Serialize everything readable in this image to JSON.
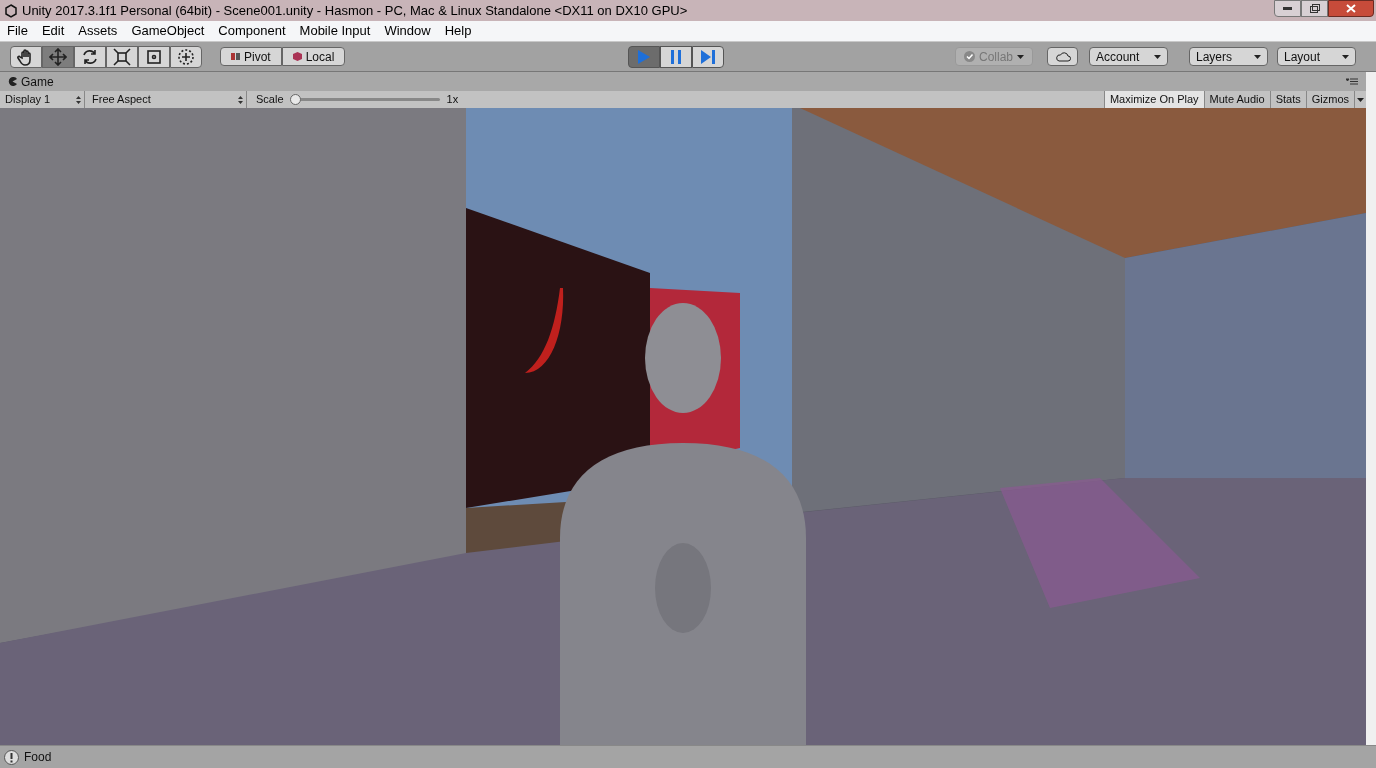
{
  "window": {
    "title": "Unity 2017.3.1f1 Personal (64bit) - Scene001.unity - Hasmon - PC, Mac & Linux Standalone <DX11 on DX10 GPU>"
  },
  "menu": [
    "File",
    "Edit",
    "Assets",
    "GameObject",
    "Component",
    "Mobile Input",
    "Window",
    "Help"
  ],
  "tools": [
    {
      "kind": "hand",
      "selected": false
    },
    {
      "kind": "move",
      "selected": true
    },
    {
      "kind": "rotate",
      "selected": false
    },
    {
      "kind": "scale",
      "selected": false
    },
    {
      "kind": "rect",
      "selected": false
    },
    {
      "kind": "transform",
      "selected": false
    }
  ],
  "pivot": {
    "label": "Pivot"
  },
  "space": {
    "label": "Local"
  },
  "play_controls": [
    {
      "kind": "play",
      "selected": true
    },
    {
      "kind": "pause",
      "selected": false
    },
    {
      "kind": "step",
      "selected": false
    }
  ],
  "collab": {
    "label": "Collab",
    "disabled": true
  },
  "account": {
    "label": "Account"
  },
  "layers": {
    "label": "Layers"
  },
  "layout": {
    "label": "Layout"
  },
  "game_view": {
    "tab": "Game",
    "display": "Display 1",
    "aspect": "Free Aspect",
    "scale_label": "Scale",
    "scale": {
      "level": 0.0
    },
    "scale_reading": "1x",
    "toggles": [
      {
        "label": "Maximize On Play",
        "selected": true
      },
      {
        "label": "Mute Audio",
        "selected": false
      },
      {
        "label": "Stats",
        "selected": false
      },
      {
        "label": "Gizmos",
        "selected": false
      }
    ]
  },
  "status_bar": {
    "message": "Food"
  }
}
